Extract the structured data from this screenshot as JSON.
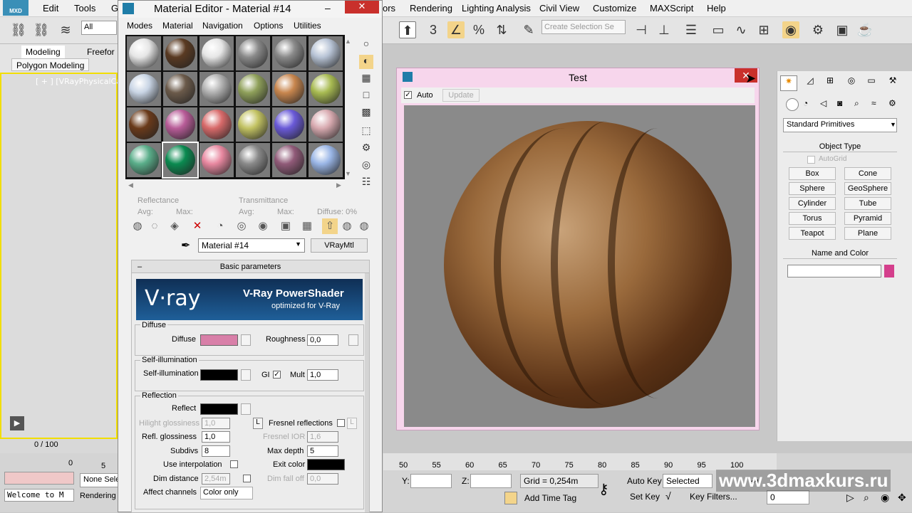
{
  "app": {
    "logo": "MXD",
    "menu": [
      "Edit",
      "Tools",
      "G",
      "ors",
      "Rendering",
      "Lighting Analysis",
      "Civil View",
      "Customize",
      "MAXScript",
      "Help"
    ],
    "selection_filter": "All",
    "selection_set_placeholder": "Create Selection Se"
  },
  "ribbon": {
    "tabs": [
      "Modeling",
      "Freefor"
    ],
    "sub": "Polygon Modeling"
  },
  "viewport": {
    "label": "[ + ] [VRayPhysicalCam"
  },
  "timeline": {
    "frame": "0 / 100",
    "ticks": [
      "0",
      "5"
    ]
  },
  "status": {
    "prompt": "Welcome to M",
    "none_sel": "None Sele",
    "rendering": "Rendering"
  },
  "material_editor": {
    "title": "Material Editor - Material #14",
    "menu": [
      "Modes",
      "Material",
      "Navigation",
      "Options",
      "Utilities"
    ],
    "reflectance_label": "Reflectance",
    "transmittance_label": "Transmittance",
    "avg_label": "Avg:",
    "max_label": "Max:",
    "diffuse_pct": "Diffuse: 0%",
    "material_name": "Material #14",
    "material_type": "VRayMtl",
    "rollout_title": "Basic parameters",
    "banner_logo": "V·ray",
    "banner_title": "V-Ray PowerShader",
    "banner_sub": "optimized for V-Ray",
    "diffuse": {
      "group": "Diffuse",
      "label": "Diffuse",
      "color": "#d87fa8",
      "roughness_label": "Roughness",
      "roughness": "0,0"
    },
    "selfillum": {
      "group": "Self-illumination",
      "label": "Self-illumination",
      "color": "#000000",
      "gi_label": "GI",
      "mult_label": "Mult",
      "mult": "1,0"
    },
    "reflection": {
      "group": "Reflection",
      "reflect_label": "Reflect",
      "reflect_color": "#000000",
      "hilight_label": "Hilight glossiness",
      "hilight": "1,0",
      "L": "L",
      "fresnel_label": "Fresnel reflections",
      "refl_gloss_label": "Refl. glossiness",
      "refl_gloss": "1,0",
      "fresnel_ior_label": "Fresnel IOR",
      "fresnel_ior": "1,6",
      "subdivs_label": "Subdivs",
      "subdivs": "8",
      "max_depth_label": "Max depth",
      "max_depth": "5",
      "interp_label": "Use interpolation",
      "exit_label": "Exit color",
      "exit_color": "#000000",
      "dim_dist_label": "Dim distance",
      "dim_dist": "2,54m",
      "dim_falloff_label": "Dim fall off",
      "dim_falloff": "0,0",
      "channels_label": "Affect channels",
      "channels": "Color only"
    },
    "slot_colors": [
      "#e6e6e6",
      "#5a3a22",
      "#e6e6e6",
      "#8a8a8a",
      "#8a8a8a",
      "#b8c4d6",
      "#c8d4e4",
      "#6b5a4a",
      "#b0b0b0",
      "#8fa05a",
      "#c8864e",
      "#a8bb52",
      "#6a3a1a",
      "#b85c98",
      "#d86a6a",
      "#c2c262",
      "#6a5ad8",
      "#d8aab0",
      "#5aae8a",
      "#0a8a50",
      "#e888a0",
      "#8a8a8a",
      "#905a78",
      "#9ab6e6"
    ]
  },
  "test_window": {
    "title": "Test",
    "auto_label": "Auto",
    "update_label": "Update"
  },
  "command_panel": {
    "dropdown": "Standard Primitives",
    "object_type": "Object Type",
    "autogrid": "AutoGrid",
    "buttons": [
      "Box",
      "Cone",
      "Sphere",
      "GeoSphere",
      "Cylinder",
      "Tube",
      "Torus",
      "Pyramid",
      "Teapot",
      "Plane"
    ],
    "name_color": "Name and Color",
    "swatch": "#d43f8c"
  },
  "bottom": {
    "ticks": [
      "50",
      "55",
      "60",
      "65",
      "70",
      "75",
      "80",
      "85",
      "90",
      "95",
      "100"
    ],
    "y_label": "Y:",
    "z_label": "Z:",
    "grid": "Grid = 0,254m",
    "auto_key": "Auto Key",
    "selected": "Selected",
    "set_key": "Set Key",
    "key_filters": "Key Filters...",
    "add_time_tag": "Add Time Tag",
    "frame_field": "0",
    "watermark": "www.3dmaxkurs.ru"
  }
}
